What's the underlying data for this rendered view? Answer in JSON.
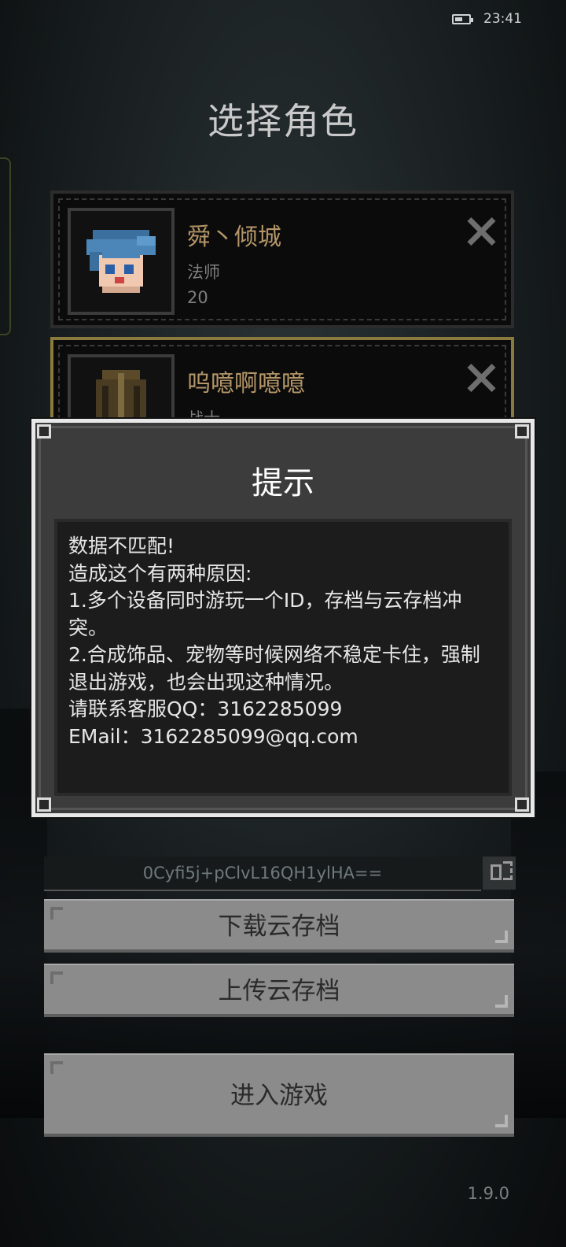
{
  "status_bar": {
    "time": "23:41",
    "battery_icon": "battery-icon"
  },
  "screen": {
    "title": "选择角色"
  },
  "characters": [
    {
      "name": "舜丶倾城",
      "class": "法师",
      "level": "20",
      "selected": false
    },
    {
      "name": "呜噫啊噫噫",
      "class": "战士",
      "level": "",
      "selected": true
    }
  ],
  "dialog": {
    "title": "提示",
    "lines": [
      "数据不匹配!",
      "造成这个有两种原因:",
      "1.多个设备同时游玩一个ID，存档与云存档冲突。",
      "2.合成饰品、宠物等时候网络不稳定卡住，强制退出游戏，也会出现这种情况。",
      "请联系客服QQ：3162285099",
      "EMail：3162285099@qq.com"
    ]
  },
  "code": {
    "value": "0Cyfi5j+pClvL16QH1ylHA=="
  },
  "buttons": {
    "download": "下载云存档",
    "upload": "上传云存档",
    "enter": "进入游戏"
  },
  "version": "1.9.0",
  "colors": {
    "name_gold": "#b49668",
    "selected_border": "#8a7a3e",
    "button_gray": "#8b8b8b",
    "dialog_bg": "#3c3c3c"
  }
}
